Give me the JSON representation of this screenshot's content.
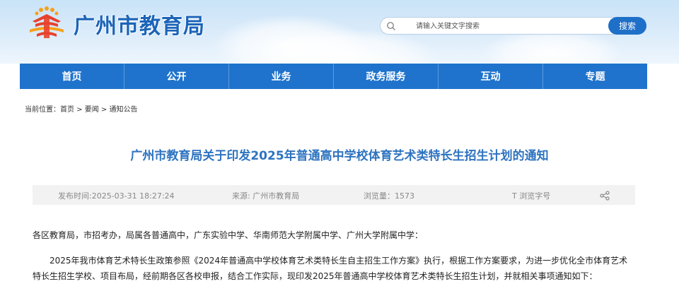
{
  "header": {
    "site_title": "广州市教育局",
    "search_placeholder": "请输入关键文字搜索",
    "search_button": "搜索"
  },
  "nav": {
    "items": [
      "首页",
      "公开",
      "业务",
      "政务服务",
      "互动",
      "专题"
    ]
  },
  "breadcrumb": {
    "prefix": "当前位置：",
    "items": [
      "首页",
      "要闻",
      "通知公告"
    ],
    "separator": " > "
  },
  "article": {
    "title": "广州市教育局关于印发2025年普通高中学校体育艺术类特长生招生计划的通知",
    "meta": {
      "publish_time": "发布时间:2025-03-31 18:27:24",
      "source": "来源: 广州市教育局",
      "views": "浏览量：1573",
      "font_size_label": "T 浏览字号"
    },
    "paragraphs": [
      "各区教育局，市招考办，局属各普通高中，广东实验中学、华南师范大学附属中学、广州大学附属中学：",
      "2025年我市体育艺术特长生政策参照《2024年普通高中学校体育艺术类特长生自主招生工作方案》执行，根据工作方案要求，为进一步优化全市体育艺术特长生招生学校、项目布局，经前期各区各校申报，结合工作实际，现印发2025年普通高中学校体育艺术类特长生招生计划，并就相关事项通知如下："
    ]
  },
  "colors": {
    "brand_blue": "#1f73cc",
    "title_blue": "#2d73c0",
    "logo_red": "#e8412c",
    "logo_orange": "#f6a01a"
  },
  "icons": {
    "logo": "education-bureau-emblem",
    "search": "search-icon",
    "share": "share-icon"
  }
}
